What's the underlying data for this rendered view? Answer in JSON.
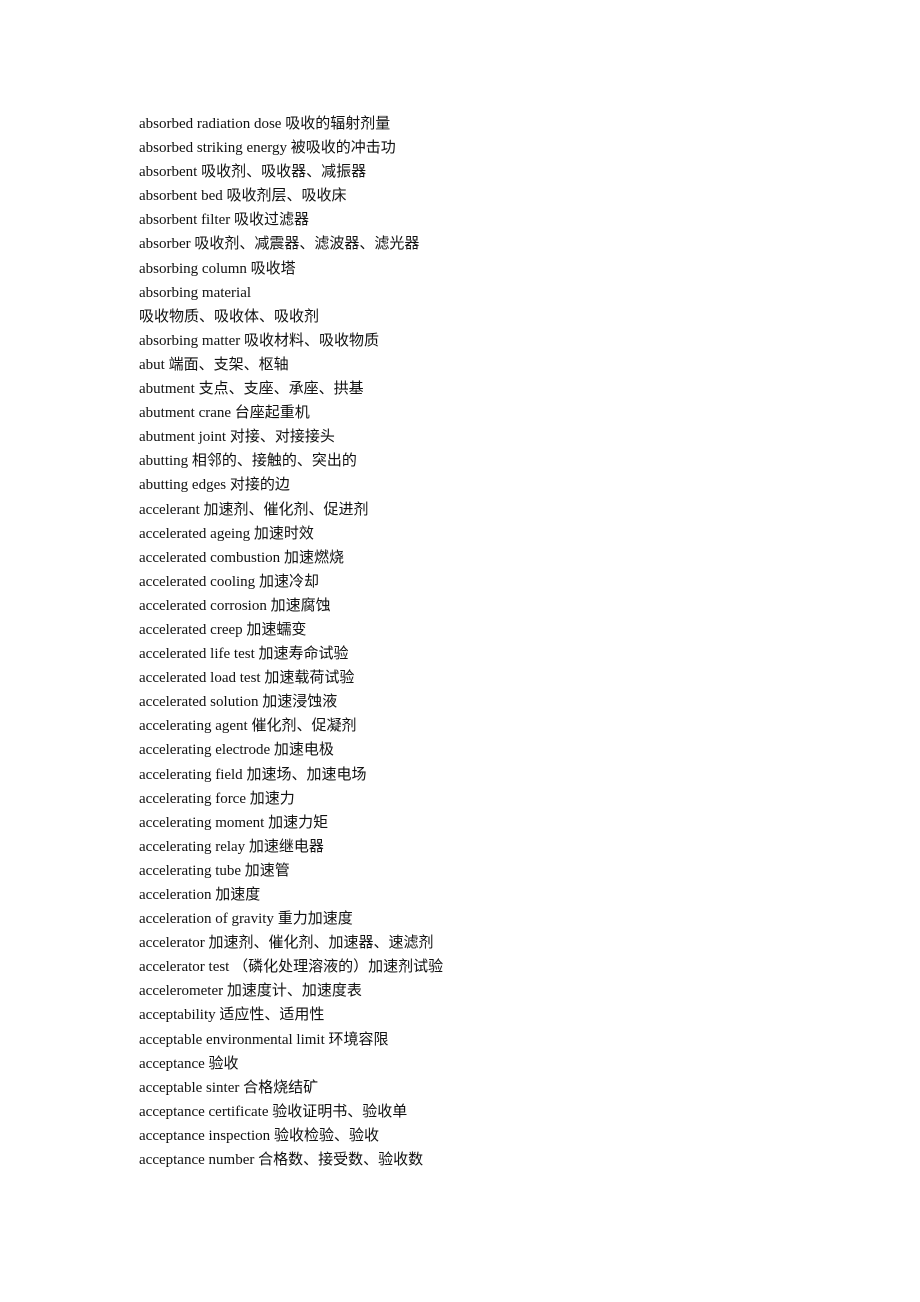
{
  "document": {
    "entries": [
      {
        "term": "absorbed radiation dose",
        "gloss": "吸收的辐射剂量"
      },
      {
        "term": "absorbed striking energy",
        "gloss": "被吸收的冲击功"
      },
      {
        "term": "absorbent",
        "gloss": "吸收剂、吸收器、减振器"
      },
      {
        "term": "absorbent bed",
        "gloss": "吸收剂层、吸收床"
      },
      {
        "term": "absorbent filter",
        "gloss": "吸收过滤器"
      },
      {
        "term": "absorber",
        "gloss": "吸收剂、减震器、滤波器、滤光器"
      },
      {
        "term": "absorbing column",
        "gloss": "吸收塔"
      },
      {
        "term": "absorbing material",
        "gloss": ""
      },
      {
        "term": "",
        "gloss": "吸收物质、吸收体、吸收剂"
      },
      {
        "term": "absorbing matter",
        "gloss": "吸收材料、吸收物质"
      },
      {
        "term": "abut",
        "gloss": "端面、支架、枢轴"
      },
      {
        "term": "abutment",
        "gloss": "支点、支座、承座、拱基"
      },
      {
        "term": "abutment crane",
        "gloss": "台座起重机"
      },
      {
        "term": "abutment joint",
        "gloss": "对接、对接接头"
      },
      {
        "term": "abutting",
        "gloss": "相邻的、接触的、突出的"
      },
      {
        "term": "abutting edges",
        "gloss": "对接的边"
      },
      {
        "term": "accelerant",
        "gloss": "加速剂、催化剂、促进剂"
      },
      {
        "term": "accelerated ageing",
        "gloss": "加速时效"
      },
      {
        "term": "accelerated combustion",
        "gloss": "加速燃烧"
      },
      {
        "term": "accelerated cooling",
        "gloss": "加速冷却"
      },
      {
        "term": "accelerated corrosion",
        "gloss": "加速腐蚀"
      },
      {
        "term": "accelerated creep",
        "gloss": "加速蠕变"
      },
      {
        "term": "accelerated life test",
        "gloss": "加速寿命试验"
      },
      {
        "term": "accelerated load test",
        "gloss": "加速载荷试验"
      },
      {
        "term": "accelerated solution",
        "gloss": "加速浸蚀液"
      },
      {
        "term": "accelerating agent",
        "gloss": "催化剂、促凝剂"
      },
      {
        "term": "accelerating electrode",
        "gloss": "加速电极"
      },
      {
        "term": "accelerating field",
        "gloss": "加速场、加速电场"
      },
      {
        "term": "accelerating force",
        "gloss": "加速力"
      },
      {
        "term": "accelerating moment",
        "gloss": "加速力矩"
      },
      {
        "term": "accelerating relay",
        "gloss": "加速继电器"
      },
      {
        "term": "accelerating tube",
        "gloss": "加速管"
      },
      {
        "term": "acceleration",
        "gloss": "加速度"
      },
      {
        "term": "acceleration of gravity",
        "gloss": "重力加速度"
      },
      {
        "term": "accelerator",
        "gloss": "加速剂、催化剂、加速器、速滤剂"
      },
      {
        "term": "accelerator test",
        "gloss": "（磷化处理溶液的）加速剂试验"
      },
      {
        "term": "accelerometer",
        "gloss": "加速度计、加速度表"
      },
      {
        "term": "acceptability",
        "gloss": "适应性、适用性"
      },
      {
        "term": "acceptable environmental limit",
        "gloss": "环境容限"
      },
      {
        "term": "acceptance",
        "gloss": "验收"
      },
      {
        "term": "acceptable sinter",
        "gloss": "合格烧结矿"
      },
      {
        "term": "acceptance certificate",
        "gloss": "验收证明书、验收单"
      },
      {
        "term": "acceptance inspection",
        "gloss": "验收检验、验收"
      },
      {
        "term": "acceptance number",
        "gloss": "合格数、接受数、验收数"
      }
    ]
  }
}
